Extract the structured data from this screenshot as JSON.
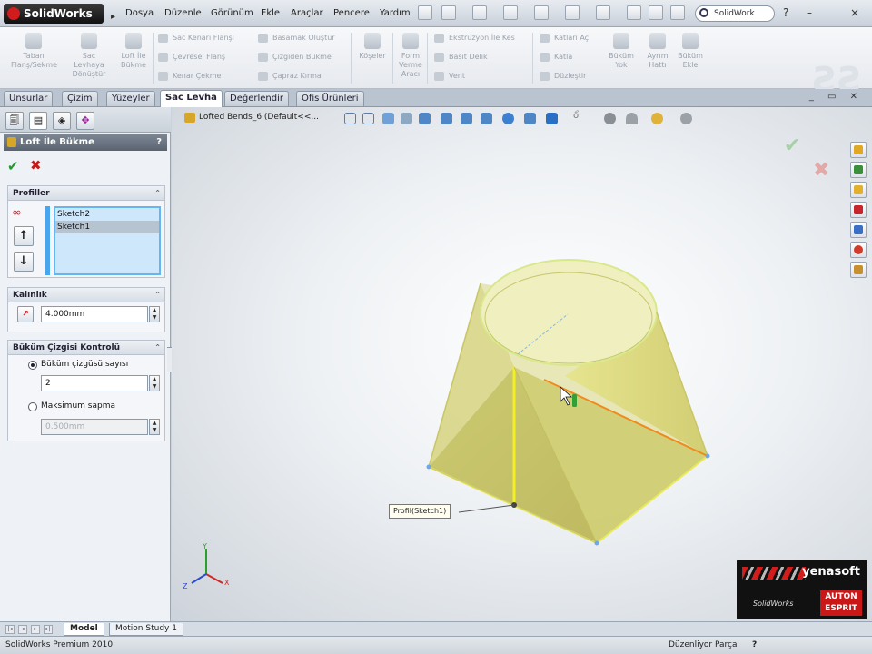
{
  "app": {
    "name": "SolidWorks"
  },
  "menu": [
    "Dosya",
    "Düzenle",
    "Görünüm",
    "Ekle",
    "Araçlar",
    "Pencere",
    "Yardım"
  ],
  "search": {
    "value": "SolidWork"
  },
  "window_controls": {
    "help": "?",
    "minimize": "–",
    "close": "×"
  },
  "command_manager": {
    "big_buttons": [
      "Taban Flanş/Sekme",
      "Sac Levhaya Dönüştür",
      "Loft İle Bükme",
      "Köşeler",
      "Form Verme Aracı",
      "Büküm Yok",
      "Ayrım Hattı",
      "Büküm Ekle"
    ],
    "small_buttons": [
      "Sac Kenarı Flanşı",
      "Çevresel Flanş",
      "Kenar Çekme",
      "Basamak Oluştur",
      "Çizgiden Bükme",
      "Çapraz Kırma",
      "Ekstrüzyon İle Kes",
      "Basit Delik",
      "Vent",
      "Katları Aç",
      "Katla",
      "Düzleştir"
    ]
  },
  "tabs": [
    "Unsurlar",
    "Çizim",
    "Yüzeyler",
    "Sac Levha",
    "Değerlendir",
    "Ofis Ürünleri"
  ],
  "active_tab": "Sac Levha",
  "property_manager": {
    "title": "Loft İle Bükme",
    "help": "?",
    "ok": "✔",
    "cancel": "✖",
    "profiles": {
      "header": "Profiller",
      "items": [
        "Sketch2",
        "Sketch1"
      ],
      "selected": "Sketch1"
    },
    "thickness": {
      "header": "Kalınlık",
      "value": "4.000mm"
    },
    "bend_control": {
      "header": "Büküm Çizgisi Kontrolü",
      "option1": "Büküm çizgüsü sayısı",
      "option1_value": "2",
      "option2": "Maksimum sapma",
      "option2_value": "0.500mm"
    }
  },
  "document": {
    "title": "Lofted Bends_6  (Default<<..."
  },
  "callout": "Profil(Sketch1)",
  "bottom_tabs": [
    "Model",
    "Motion Study 1"
  ],
  "status": {
    "left": "SolidWorks Premium 2010",
    "right": "Düzenliyor Parça",
    "help": "?"
  },
  "watermark": {
    "brand": "yenasoft",
    "sw": "SolidWorks",
    "auton": "AUTON ESPRIT"
  },
  "colors": {
    "accent": "#49a6ec",
    "shape_fill": "#d6d27a",
    "shape_edge": "#e8e85a",
    "orange_edge": "#f08a1c"
  }
}
